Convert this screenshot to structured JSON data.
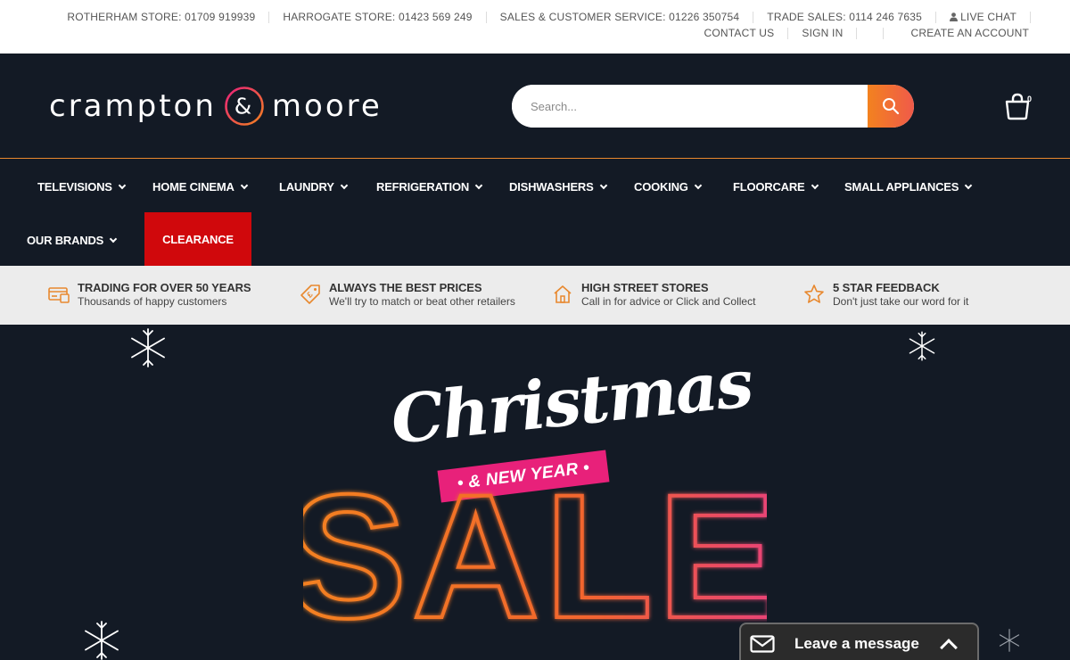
{
  "topbar": {
    "rotherham": "ROTHERHAM STORE: 01709 919939",
    "harrogate": "HARROGATE STORE: 01423 569 249",
    "sales": "SALES & CUSTOMER SERVICE: 01226 350754",
    "trade": "TRADE SALES: 0114 246 7635",
    "live_chat": "LIVE CHAT",
    "contact": "CONTACT US",
    "sign_in": "SIGN IN",
    "create_account": "CREATE AN ACCOUNT"
  },
  "header": {
    "logo_left": "crampton",
    "logo_amp": "&",
    "logo_right": "moore",
    "search_placeholder": "Search...",
    "cart_count": "0"
  },
  "nav": {
    "items": [
      {
        "label": "TELEVISIONS"
      },
      {
        "label": "HOME CINEMA"
      },
      {
        "label": "LAUNDRY"
      },
      {
        "label": "REFRIGERATION"
      },
      {
        "label": "DISHWASHERS"
      },
      {
        "label": "COOKING"
      },
      {
        "label": "FLOORCARE"
      },
      {
        "label": "SMALL APPLIANCES"
      },
      {
        "label": "OUR BRANDS"
      }
    ],
    "clearance": "CLEARANCE"
  },
  "usp": [
    {
      "title": "TRADING FOR OVER 50 YEARS",
      "sub": "Thousands of happy customers",
      "icon": "card-icon"
    },
    {
      "title": "ALWAYS THE BEST PRICES",
      "sub": "We'll try to match or beat other retailers",
      "icon": "price-tag-icon"
    },
    {
      "title": "HIGH STREET STORES",
      "sub": "Call in for advice or Click and Collect",
      "icon": "house-icon"
    },
    {
      "title": "5 STAR FEEDBACK",
      "sub": "Don't just take our word for it",
      "icon": "star-icon"
    }
  ],
  "hero": {
    "script": "Christmas",
    "ribbon": "• & NEW YEAR •",
    "sale": "SALE"
  },
  "chat": {
    "label": "Leave a message"
  },
  "colors": {
    "dark": "#131a25",
    "accent": "#f3821f",
    "clearance": "#d0080c",
    "pink": "#e8217a"
  }
}
